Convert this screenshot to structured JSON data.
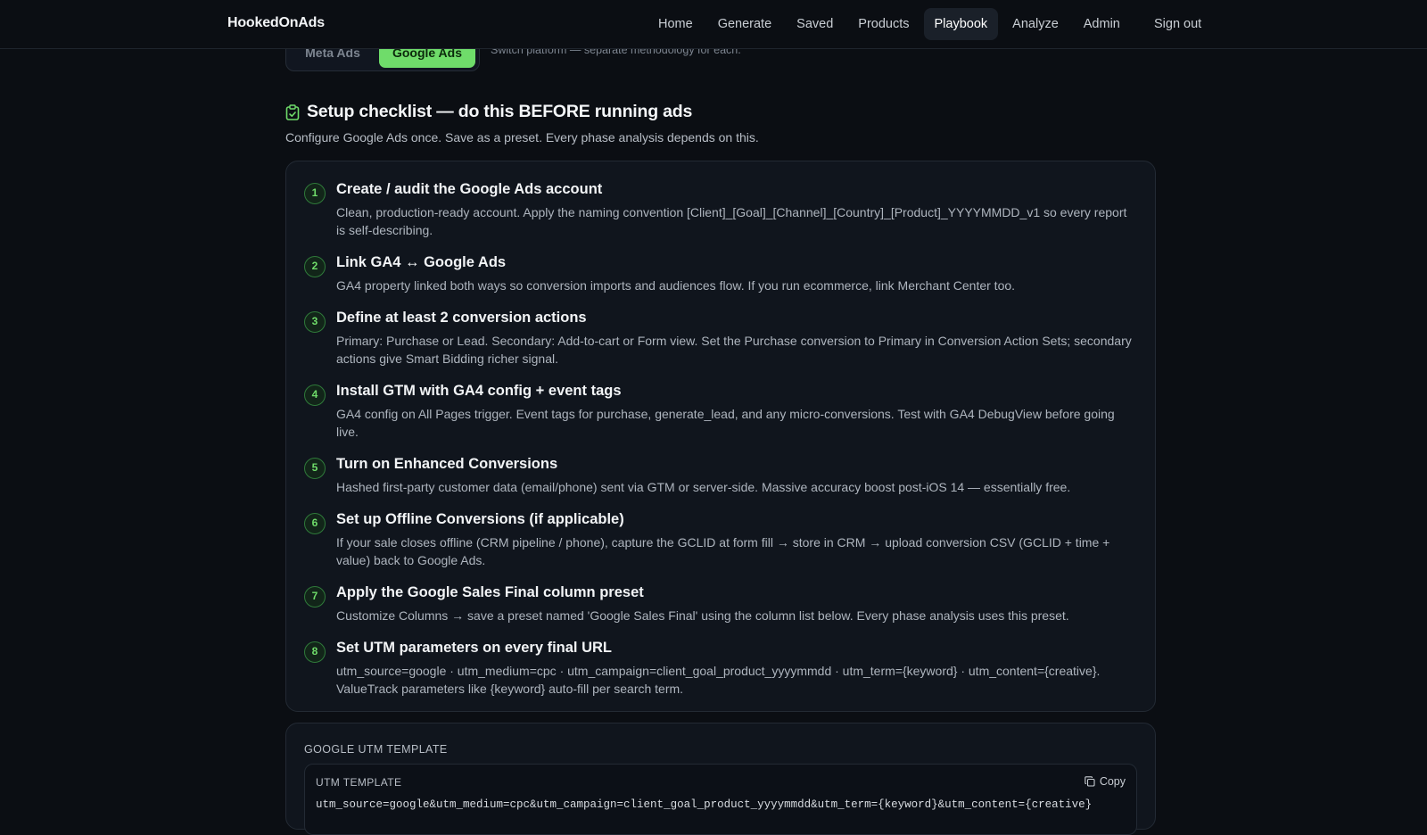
{
  "app": {
    "brand": "HookedOnAds"
  },
  "nav": {
    "items": [
      "Home",
      "Generate",
      "Saved",
      "Products",
      "Playbook",
      "Analyze",
      "Admin"
    ],
    "active": "Playbook",
    "signout": "Sign out"
  },
  "platform": {
    "options": [
      "Meta Ads",
      "Google Ads"
    ],
    "selected": "Google Ads",
    "hint": "Switch platform — separate methodology for each."
  },
  "colors": {
    "accent": "#6fdc6a",
    "background": "#0b0e13",
    "card": "#10151d"
  },
  "checklist": {
    "icon": "clipboard-check-icon",
    "title": "Setup checklist — do this BEFORE running ads",
    "subtitle": "Configure Google Ads once. Save as a preset. Every phase analysis depends on this.",
    "steps": [
      {
        "num": "1",
        "title": "Create / audit the Google Ads account",
        "desc": "Clean, production-ready account. Apply the naming convention [Client]_[Goal]_[Channel]_[Country]_[Product]_YYYYMMDD_v1 so every report is self-describing."
      },
      {
        "num": "2",
        "title": "Link GA4 ↔ Google Ads",
        "desc": "GA4 property linked both ways so conversion imports and audiences flow. If you run ecommerce, link Merchant Center too."
      },
      {
        "num": "3",
        "title": "Define at least 2 conversion actions",
        "desc": "Primary: Purchase or Lead. Secondary: Add-to-cart or Form view. Set the Purchase conversion to Primary in Conversion Action Sets; secondary actions give Smart Bidding richer signal."
      },
      {
        "num": "4",
        "title": "Install GTM with GA4 config + event tags",
        "desc": "GA4 config on All Pages trigger. Event tags for purchase, generate_lead, and any micro-conversions. Test with GA4 DebugView before going live."
      },
      {
        "num": "5",
        "title": "Turn on Enhanced Conversions",
        "desc": "Hashed first-party customer data (email/phone) sent via GTM or server-side. Massive accuracy boost post-iOS 14 — essentially free."
      },
      {
        "num": "6",
        "title": "Set up Offline Conversions (if applicable)",
        "desc": "If your sale closes offline (CRM pipeline / phone), capture the GCLID at form fill → store in CRM → upload conversion CSV (GCLID + time + value) back to Google Ads."
      },
      {
        "num": "7",
        "title": "Apply the Google Sales Final column preset",
        "desc": "Customize Columns → save a preset named 'Google Sales Final' using the column list below. Every phase analysis uses this preset."
      },
      {
        "num": "8",
        "title": "Set UTM parameters on every final URL",
        "desc": "utm_source=google · utm_medium=cpc · utm_campaign=client_goal_product_yyyymmdd · utm_term={keyword} · utm_content={creative}. ValueTrack parameters like {keyword} auto-fill per search term."
      }
    ]
  },
  "utm": {
    "section_label": "GOOGLE UTM TEMPLATE",
    "inner_label": "UTM TEMPLATE",
    "copy_label": "Copy",
    "code": "utm_source=google&utm_medium=cpc&utm_campaign=client_goal_product_yyyymmdd&utm_term={keyword}&utm_content={creative}"
  }
}
